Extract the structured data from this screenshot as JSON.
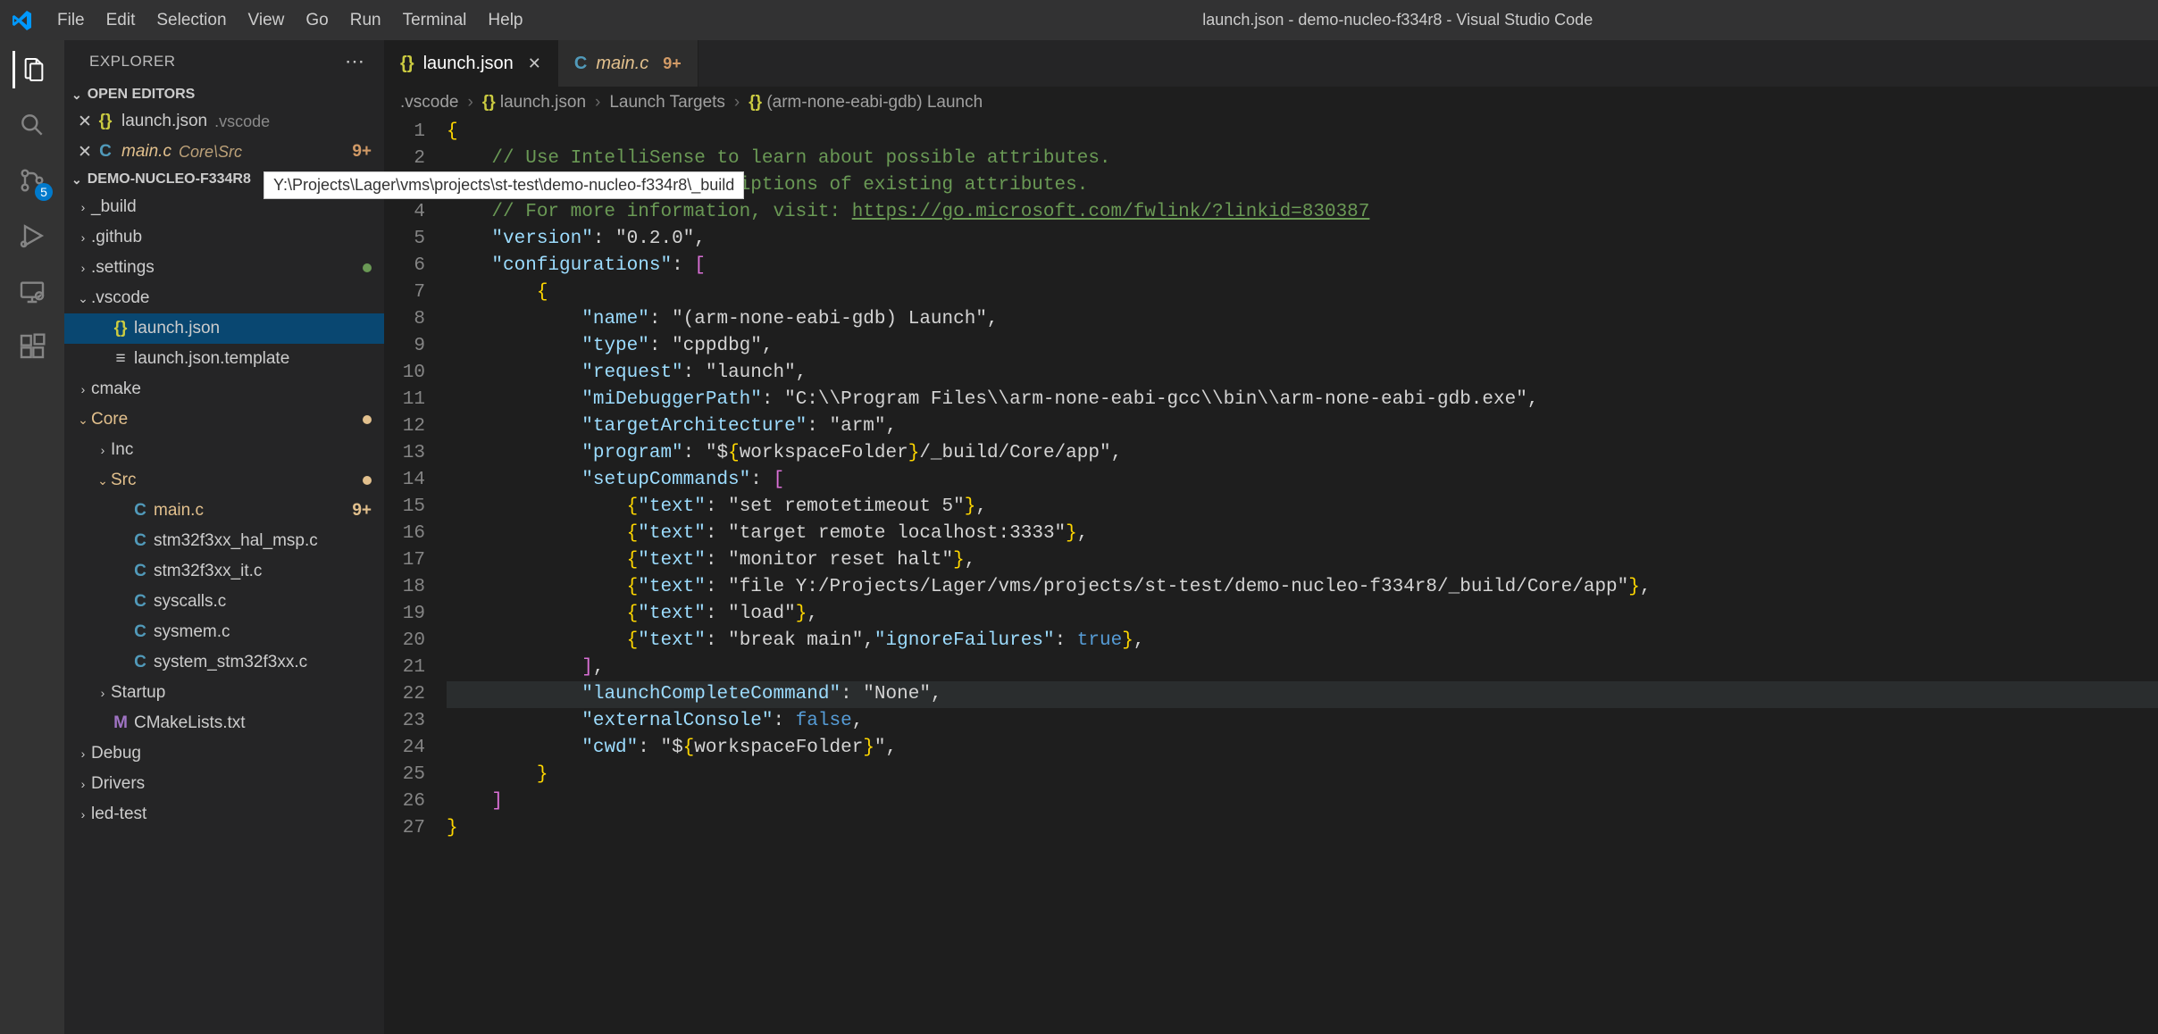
{
  "window_title": "launch.json - demo-nucleo-f334r8 - Visual Studio Code",
  "menu": [
    "File",
    "Edit",
    "Selection",
    "View",
    "Go",
    "Run",
    "Terminal",
    "Help"
  ],
  "activity": {
    "scm_badge": "5"
  },
  "sidebar": {
    "title": "EXPLORER",
    "open_editors_label": "OPEN EDITORS",
    "open_editors": [
      {
        "icon": "{}",
        "name": "launch.json",
        "hint": ".vscode",
        "modified": false
      },
      {
        "icon": "C",
        "name": "main.c",
        "hint": "Core\\Src",
        "modified": true,
        "badge": "9+"
      }
    ],
    "project_label": "DEMO-NUCLEO-F334R8",
    "tree": [
      {
        "indent": 0,
        "type": "folder",
        "open": false,
        "name": "_build"
      },
      {
        "indent": 0,
        "type": "folder",
        "open": false,
        "name": ".github"
      },
      {
        "indent": 0,
        "type": "folder",
        "open": false,
        "name": ".settings",
        "dot": "green"
      },
      {
        "indent": 0,
        "type": "folder",
        "open": true,
        "name": ".vscode"
      },
      {
        "indent": 1,
        "type": "file",
        "icon": "{}",
        "name": "launch.json",
        "selected": true
      },
      {
        "indent": 1,
        "type": "file",
        "icon": "≡",
        "name": "launch.json.template"
      },
      {
        "indent": 0,
        "type": "folder",
        "open": false,
        "name": "cmake"
      },
      {
        "indent": 0,
        "type": "folder",
        "open": true,
        "name": "Core",
        "modified": true,
        "dot": "mod"
      },
      {
        "indent": 1,
        "type": "folder",
        "open": false,
        "name": "Inc"
      },
      {
        "indent": 1,
        "type": "folder",
        "open": true,
        "name": "Src",
        "modified": true,
        "dot": "mod"
      },
      {
        "indent": 2,
        "type": "file",
        "icon": "C",
        "name": "main.c",
        "modified": true,
        "badge": "9+"
      },
      {
        "indent": 2,
        "type": "file",
        "icon": "C",
        "name": "stm32f3xx_hal_msp.c"
      },
      {
        "indent": 2,
        "type": "file",
        "icon": "C",
        "name": "stm32f3xx_it.c"
      },
      {
        "indent": 2,
        "type": "file",
        "icon": "C",
        "name": "syscalls.c"
      },
      {
        "indent": 2,
        "type": "file",
        "icon": "C",
        "name": "sysmem.c"
      },
      {
        "indent": 2,
        "type": "file",
        "icon": "C",
        "name": "system_stm32f3xx.c"
      },
      {
        "indent": 1,
        "type": "folder",
        "open": false,
        "name": "Startup"
      },
      {
        "indent": 1,
        "type": "file",
        "icon": "M",
        "name": "CMakeLists.txt"
      },
      {
        "indent": 0,
        "type": "folder",
        "open": false,
        "name": "Debug"
      },
      {
        "indent": 0,
        "type": "folder",
        "open": false,
        "name": "Drivers"
      },
      {
        "indent": 0,
        "type": "folder",
        "open": false,
        "name": "led-test"
      }
    ]
  },
  "tabs": [
    {
      "icon": "{}",
      "label": "launch.json",
      "active": true,
      "close": true
    },
    {
      "icon": "C",
      "label": "main.c",
      "modified": true,
      "badge": "9+"
    }
  ],
  "breadcrumb": [
    ".vscode",
    "{} launch.json",
    "Launch Targets",
    "{} (arm-none-eabi-gdb) Launch"
  ],
  "tooltip": "Y:\\Projects\\Lager\\vms\\projects\\st-test\\demo-nucleo-f334r8\\_build",
  "code": {
    "lines": [
      "{",
      "    // Use IntelliSense to learn about possible attributes.",
      "    // Hover to view descriptions of existing attributes.",
      "    // For more information, visit: https://go.microsoft.com/fwlink/?linkid=830387",
      "    \"version\": \"0.2.0\",",
      "    \"configurations\": [",
      "        {",
      "            \"name\": \"(arm-none-eabi-gdb) Launch\",",
      "            \"type\": \"cppdbg\",",
      "            \"request\": \"launch\",",
      "            \"miDebuggerPath\": \"C:\\\\Program Files\\\\arm-none-eabi-gcc\\\\bin\\\\arm-none-eabi-gdb.exe\",",
      "            \"targetArchitecture\": \"arm\",",
      "            \"program\": \"${workspaceFolder}/_build/Core/app\",",
      "            \"setupCommands\": [",
      "                {\"text\": \"set remotetimeout 5\"},",
      "                {\"text\": \"target remote localhost:3333\"},",
      "                {\"text\": \"monitor reset halt\"},",
      "                {\"text\": \"file Y:/Projects/Lager/vms/projects/st-test/demo-nucleo-f334r8/_build/Core/app\"},",
      "                {\"text\": \"load\"},",
      "                {\"text\": \"break main\",\"ignoreFailures\": true},",
      "            ],",
      "            \"launchCompleteCommand\": \"None\",",
      "            \"externalConsole\": false,",
      "            \"cwd\": \"${workspaceFolder}\",",
      "        }",
      "    ]",
      "}"
    ],
    "current_line": 22
  }
}
